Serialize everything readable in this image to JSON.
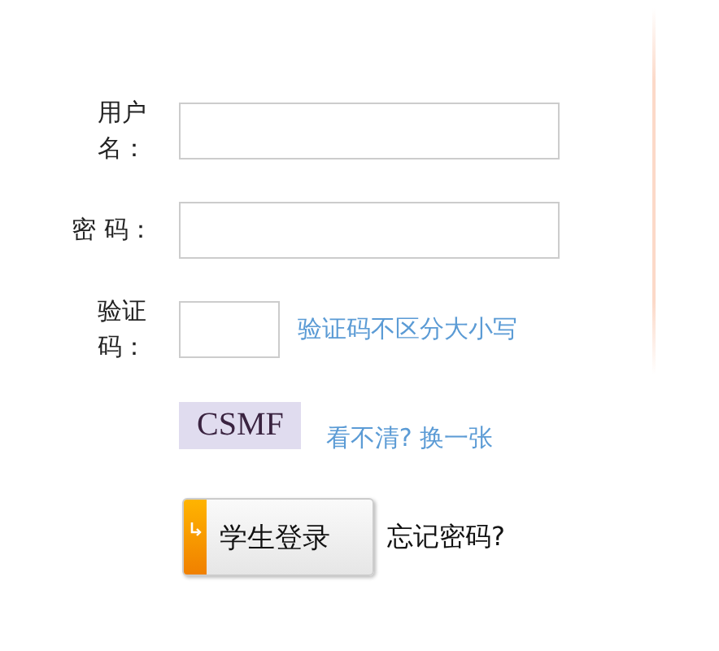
{
  "fields": [
    {
      "kind": "text",
      "label": "用户名："
    },
    {
      "kind": "password",
      "label": "密 码："
    },
    {
      "kind": "captcha",
      "label": "验证码：",
      "hint": "验证码不区分大小写"
    }
  ],
  "captcha": {
    "code": "CSMF",
    "refresh_link": "看不清? 换一张"
  },
  "login_button": "学生登录",
  "forgot_link": "忘记密码?"
}
